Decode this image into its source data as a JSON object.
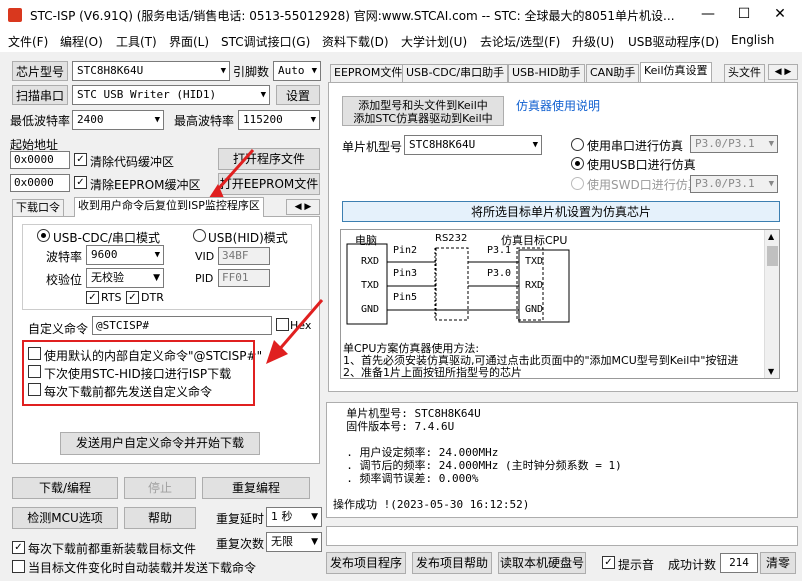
{
  "window": {
    "title": "STC-ISP (V6.91Q) (服务电话/销售电话: 0513-55012928) 官网:www.STCAI.com -- STC: 全球最大的8051单片机设...",
    "min": "—",
    "max": "☐",
    "close": "✕"
  },
  "menu": [
    "文件(F)",
    "编程(O)",
    "工具(T)",
    "界面(L)",
    "STC调试接口(G)",
    "资料下载(D)",
    "大学计划(U)",
    "去论坛/选型(F)",
    "升级(U)",
    "USB驱动程序(D)",
    "English"
  ],
  "left": {
    "chip_label": "芯片型号",
    "chip_value": "STC8H8K64U",
    "pin_label": "引脚数",
    "pin_value": "Auto",
    "scan_label": "扫描串口",
    "port_value": "STC USB Writer (HID1)",
    "settings_label": "设置",
    "min_baud_label": "最低波特率",
    "min_baud_value": "2400",
    "max_baud_label": "最高波特率",
    "max_baud_value": "115200",
    "start_addr_label": "起始地址",
    "addr1": "0x0000",
    "clear_code": "清除代码缓冲区",
    "open_prog": "打开程序文件",
    "addr2": "0x0000",
    "clear_eeprom": "清除EEPROM缓冲区",
    "open_eeprom": "打开EEPROM文件",
    "tabs": [
      "下载口令",
      "收到用户命令后复位到ISP监控程序区"
    ],
    "usb_cdc_mode": "USB-CDC/串口模式",
    "usb_hid_mode": "USB(HID)模式",
    "baud_label": "波特率",
    "baud_value": "9600",
    "parity_label": "校验位",
    "parity_value": "无校验",
    "rts": "RTS",
    "dtr": "DTR",
    "vid_label": "VID",
    "vid_value": "34BF",
    "pid_label": "PID",
    "pid_value": "FF01",
    "custom_cmd_label": "自定义命令",
    "custom_cmd_value": "@STCISP#",
    "hex": "Hex",
    "opt1": "使用默认的内部自定义命令\"@STCISP#\"",
    "opt2": "下次使用STC-HID接口进行ISP下载",
    "opt3": "每次下载前都先发送自定义命令",
    "send_btn": "发送用户自定义命令并开始下载",
    "download_btn": "下载/编程",
    "stop_btn": "停止",
    "reprog_btn": "重复编程",
    "detect_btn": "检测MCU选项",
    "help_btn": "帮助",
    "delay_label": "重复延时",
    "delay_value": "1 秒",
    "count_label": "重复次数",
    "count_value": "无限",
    "reload_cb": "每次下载前都重新装载目标文件",
    "auto_cb": "当目标文件变化时自动装载并发送下载命令"
  },
  "right": {
    "tabs": [
      "EEPROM文件",
      "USB-CDC/串口助手",
      "USB-HID助手",
      "CAN助手",
      "Keil仿真设置",
      "头文件"
    ],
    "add_keil_btn_line1": "添加型号和头文件到Keil中",
    "add_keil_btn_line2": "添加STC仿真器驱动到Keil中",
    "emu_manual": "仿真器使用说明",
    "mcu_label": "单片机型号",
    "mcu_value": "STC8H8K64U",
    "serial_emu": "使用串口进行仿真",
    "serial_emu_port": "P3.0/P3.1",
    "usb_emu": "使用USB口进行仿真",
    "swd_emu": "使用SWD口进行仿真",
    "swd_emu_port": "P3.0/P3.1",
    "set_emu_btn": "将所选目标单片机设置为仿真芯片",
    "diagram": {
      "pc": "电脑",
      "rs232": "RS232",
      "target": "仿真目标CPU",
      "rxd": "RXD",
      "txd": "TXD",
      "gnd": "GND",
      "pin2": "Pin2",
      "pin3": "Pin3",
      "pin5": "Pin5",
      "p31": "P3.1",
      "p30": "P3.0",
      "t_txd": "TXD",
      "t_rxd": "RXD",
      "t_gnd": "GND",
      "text1": "单CPU方案仿真器使用方法:",
      "text2": "1、首先必须安装仿真驱动,可通过点击此页面中的\"添加MCU型号到Keil中\"按钮进",
      "text3": "2、准备1片上面按钮所指型号的芯片"
    },
    "log": [
      "  单片机型号: STC8H8K64U",
      "  固件版本号: 7.4.6U",
      "",
      "  . 用户设定频率: 24.000MHz",
      "  . 调节后的频率: 24.000MHz (主时钟分频系数 = 1)",
      "  . 频率调节误差: 0.000%",
      "",
      "操作成功 !(2023-05-30 16:12:52)"
    ],
    "publish_btn": "发布项目程序",
    "publish_help_btn": "发布项目帮助",
    "read_disk_btn": "读取本机硬盘号",
    "beep_label": "提示音",
    "success_label": "成功计数",
    "success_value": "214",
    "clear_btn": "清零"
  }
}
